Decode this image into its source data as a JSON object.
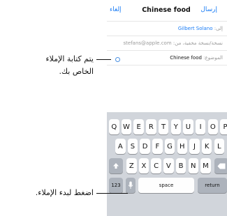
{
  "mail": {
    "send": "إرسال",
    "title": "Chinese food",
    "cancel": "إلغاء",
    "to_label": "إلى:",
    "to_value": "Gilbert Solano",
    "cc_bcc": "نسخة/نسخة مخفية، من: stefans@apple.com",
    "subject_label": "الموضوع:",
    "subject_value": "Chinese food"
  },
  "keyboard": {
    "row1": [
      "Q",
      "W",
      "E",
      "R",
      "T",
      "Y",
      "U",
      "I",
      "O",
      "P"
    ],
    "row2": [
      "A",
      "S",
      "D",
      "F",
      "G",
      "H",
      "J",
      "K",
      "L"
    ],
    "row3": [
      "Z",
      "X",
      "C",
      "V",
      "B",
      "N",
      "M"
    ],
    "numbers": "123",
    "space": "space",
    "return": "return"
  },
  "callouts": {
    "dictation_line1": "يتم كتابة الإملاء",
    "dictation_line2": "الخاص بك.",
    "mic": "اضغط لبدء الإملاء."
  }
}
